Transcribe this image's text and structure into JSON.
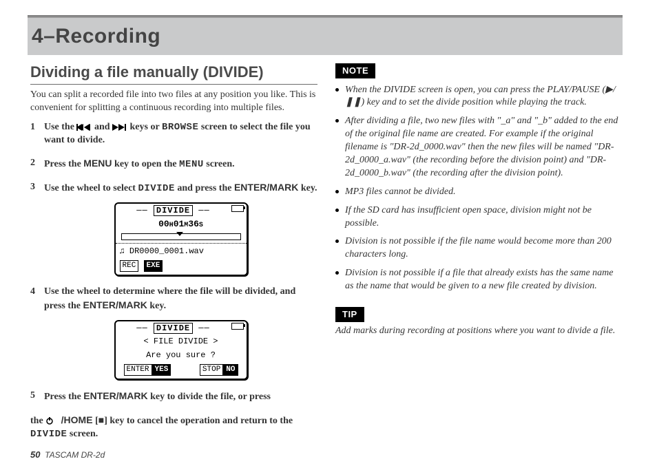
{
  "chapter": {
    "title": "4–Recording"
  },
  "section": {
    "title": "Dividing a file manually (DIVIDE)"
  },
  "intro": "You can split a recorded file into two files at any position you like. This is convenient for splitting a continuous recording into multiple files.",
  "keys": {
    "browse": "BROWSE",
    "menu_key": "MENU",
    "menu_screen": "MENU",
    "divide": "DIVIDE",
    "enter_mark": "ENTER/MARK",
    "home": "/HOME",
    "stop_glyph": "■",
    "play_glyph": "▶",
    "pause_glyph": "❚❚"
  },
  "steps": {
    "s1a": "Use the ",
    "s1b": " and ",
    "s1c": " keys or ",
    "s1d": " screen to select the file you want to divide.",
    "s2a": "Press the ",
    "s2b": " key to open the ",
    "s2c": " screen.",
    "s3a": "Use the wheel to select ",
    "s3b": " and press the ",
    "s3c": " key.",
    "s4a": "Use the wheel to determine where the file will be divided, and press the ",
    "s4b": " key.",
    "s5a": "Press the ",
    "s5b": " key to divide the file, or press"
  },
  "cont": {
    "a": "the ",
    "b": " [",
    "c": "] key to cancel the operation and return to the ",
    "d": " screen."
  },
  "lcd1": {
    "title": "DIVIDE",
    "time": "00H01M36S",
    "file": "DR0000_0001.wav",
    "rec": "REC",
    "exe": "EXE"
  },
  "lcd2": {
    "title": "DIVIDE",
    "line1": "< FILE DIVIDE >",
    "line2": "Are you sure ?",
    "enter": "ENTER",
    "yes": "YES",
    "stop": "STOP",
    "no": "NO"
  },
  "note": {
    "label": "NOTE",
    "items": [
      "When the DIVIDE screen is open, you can press the PLAY/PAUSE (▶/❚❚) key and to set the divide position while playing the track.",
      "After dividing a file, two new files with \"_a\" and \"_b\" added to the end of the original file name are created. For example if the original filename is \"DR-2d_0000.wav\" then the new files will be named \"DR-2d_0000_a.wav\" (the recording before the division point) and \"DR-2d_0000_b.wav\" (the recording after the division point).",
      "MP3 files cannot be divided.",
      "If the SD card has insufficient open space, division might not be possible.",
      "Division is not possible if the file name would become more than 200 characters long.",
      "Division is not possible if a file that already exists has the same name as the name that would be given to a new file created by division."
    ]
  },
  "tip": {
    "label": "TIP",
    "body": "Add marks during recording at positions where you want to divide a file."
  },
  "footer": {
    "page": "50",
    "model": "TASCAM  DR-2d"
  }
}
